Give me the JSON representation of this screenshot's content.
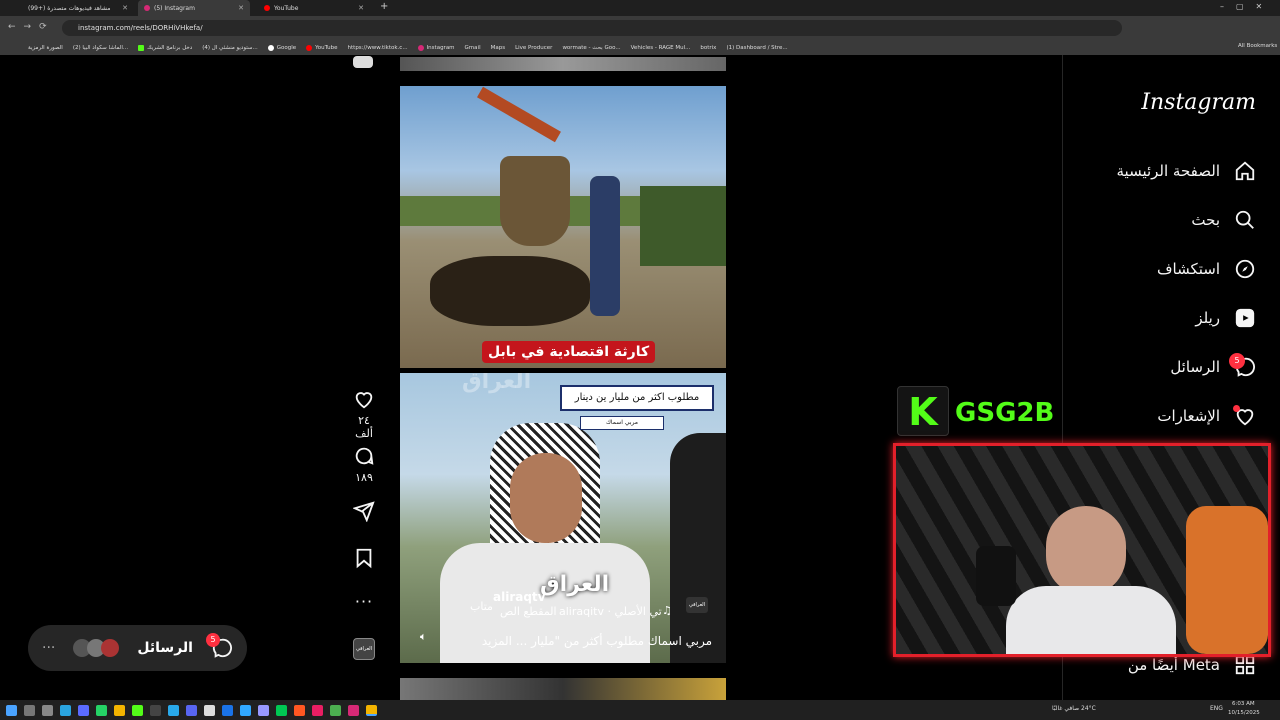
{
  "browser": {
    "tabs": [
      {
        "title": "(99+) مشاهد فيديوهات متصدرة",
        "active": false
      },
      {
        "title": "(5) Instagram",
        "active": true
      },
      {
        "title": "YouTube",
        "active": false
      }
    ],
    "url": "instagram.com/reels/DORHiVHkefa/",
    "bookmarks": [
      "الصورة الرمزية",
      "(2) الماشا سكواد البيا...",
      "دخل برنامج الشريك",
      "(4) ستوديو منشئي ال...",
      "Google",
      "YouTube",
      "https://www.tiktok.c...",
      "Instagram",
      "Gmail",
      "Maps",
      "Live Producer",
      "wormate - بحث Goo...",
      "Vehicles - RAGE Mul...",
      "botrix",
      "(1) Dashboard / Stre..."
    ],
    "all_bookmarks": "All Bookmarks"
  },
  "sidebar": {
    "logo": "Instagram",
    "items": [
      {
        "label": "الصفحة الرئيسية",
        "icon": "home-icon"
      },
      {
        "label": "بحث",
        "icon": "search-icon"
      },
      {
        "label": "استكشاف",
        "icon": "compass-icon"
      },
      {
        "label": "ريلز",
        "icon": "reels-icon"
      },
      {
        "label": "الرسائل",
        "icon": "messenger-icon",
        "badge": "5"
      },
      {
        "label": "الإشعارات",
        "icon": "heart-icon"
      }
    ],
    "more_from_meta": "أيضًا من Meta"
  },
  "reel": {
    "caption_top": "كارثة اقتصادية في بابل",
    "quote_box": "مطلوب اكثر من مليار ين دينار",
    "quote_sub": "مربي اسماك",
    "channel_watermark": "العراق",
    "user": "aliraqtv",
    "audio": "تي الأصلي · aliraqitv",
    "audio_short": "المقطع الص",
    "follow": "متاب",
    "description": "مربي اسماك مطلوب أكثر من \"مليار ... المزيد",
    "likes": "٢٤ ألف",
    "comments": "١٨٩",
    "corner_logo": "العراقي"
  },
  "messages_bar": {
    "label": "الرسائل",
    "badge": "5"
  },
  "overlay": {
    "name": "GSG2B",
    "logo_letter": "K"
  },
  "taskbar": {
    "weather": "24°C صافي غالبًا",
    "lang": "ENG",
    "time": "6:03 AM",
    "date": "10/15/2025"
  },
  "colors": {
    "accent": "#ff3040",
    "overlay_green": "#53fc18",
    "overlay_border": "#e3202a"
  }
}
